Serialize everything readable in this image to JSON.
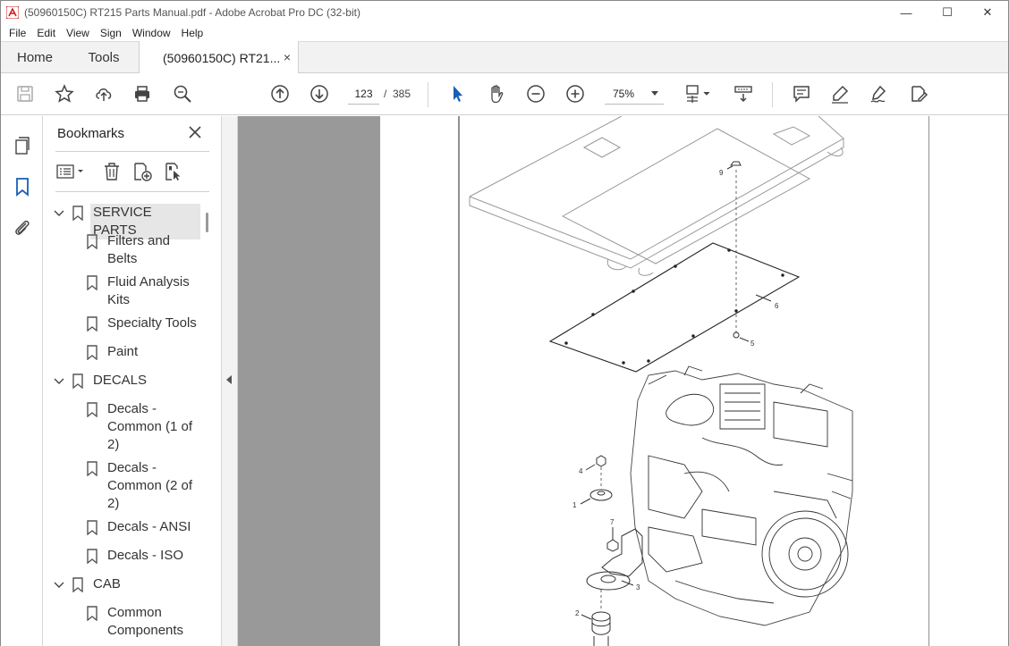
{
  "window": {
    "title": "(50960150C) RT215 Parts Manual.pdf - Adobe Acrobat Pro DC (32-bit)",
    "controls": [
      "—",
      "☐",
      "✕"
    ]
  },
  "menu": [
    "File",
    "Edit",
    "View",
    "Sign",
    "Window",
    "Help"
  ],
  "tabs": {
    "home": "Home",
    "tools": "Tools",
    "document": "(50960150C) RT21...",
    "close": "×"
  },
  "toolbar": {
    "icons": [
      "save-icon",
      "star-icon",
      "upload-icon",
      "print-icon",
      "zoom-search-icon",
      "page-up-icon",
      "page-down-icon",
      "select-arrow-icon",
      "hand-icon",
      "zoom-out-icon",
      "zoom-in-icon",
      "fit-page-icon",
      "scroll-mode-icon",
      "comment-icon",
      "highlight-icon",
      "sign-icon",
      "edit-pdf-icon"
    ],
    "page_current": "123",
    "page_sep": "/",
    "page_total": "385",
    "zoom": "75%"
  },
  "bookmarks": {
    "header": "Bookmarks",
    "items": [
      {
        "label": "SERVICE PARTS",
        "level": 0,
        "expanded": true,
        "selected": true
      },
      {
        "label": "Filters and Belts",
        "level": 1
      },
      {
        "label": "Fluid Analysis Kits",
        "level": 1
      },
      {
        "label": "Specialty Tools",
        "level": 1
      },
      {
        "label": "Paint",
        "level": 1
      },
      {
        "label": "DECALS",
        "level": 0,
        "expanded": true
      },
      {
        "label": "Decals - Common (1 of 2)",
        "level": 1
      },
      {
        "label": "Decals - Common (2 of 2)",
        "level": 1
      },
      {
        "label": "Decals - ANSI",
        "level": 1
      },
      {
        "label": "Decals - ISO",
        "level": 1
      },
      {
        "label": "CAB",
        "level": 0,
        "expanded": true
      },
      {
        "label": "Common Components",
        "level": 1
      }
    ]
  },
  "drawing": {
    "callouts": [
      "9",
      "6",
      "5",
      "4",
      "1",
      "7",
      "3",
      "2"
    ]
  }
}
